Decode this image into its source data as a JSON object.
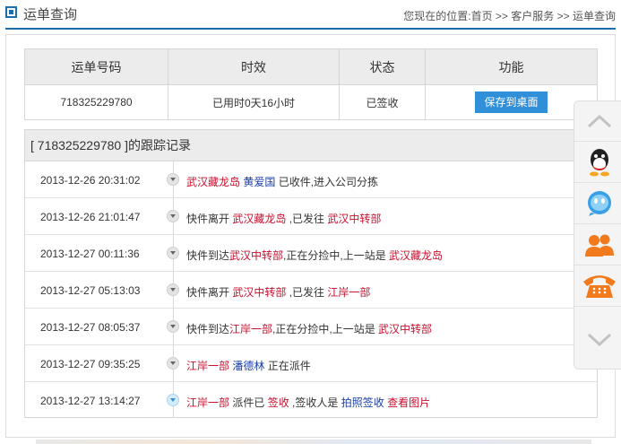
{
  "header": {
    "title": "运单查询",
    "breadcrumb": {
      "prefix": "您现在的位置:",
      "home": "首页",
      "sep1": " >> ",
      "service": "客户服务",
      "sep2": " >> ",
      "current": "运单查询"
    }
  },
  "summary": {
    "columns": [
      "运单号码",
      "时效",
      "状态",
      "功能"
    ],
    "row": {
      "tracking_number": "718325229780",
      "duration": "已用时0天16小时",
      "status": "已签收",
      "action_label": "保存到桌面"
    }
  },
  "tracking": {
    "title": "[ 718325229780 ]的跟踪记录",
    "records": [
      {
        "time": "2013-12-26 20:31:02",
        "parts": [
          {
            "t": "武汉藏龙岛",
            "c": "red"
          },
          {
            "t": " ",
            "c": ""
          },
          {
            "t": "黄爱国",
            "c": "blue"
          },
          {
            "t": " 已收件,进入公司分拣",
            "c": ""
          }
        ]
      },
      {
        "time": "2013-12-26 21:01:47",
        "parts": [
          {
            "t": "快件离开 ",
            "c": ""
          },
          {
            "t": "武汉藏龙岛",
            "c": "red"
          },
          {
            "t": " ,已发往 ",
            "c": ""
          },
          {
            "t": "武汉中转部",
            "c": "red"
          }
        ]
      },
      {
        "time": "2013-12-27 00:11:36",
        "parts": [
          {
            "t": "快件到达",
            "c": ""
          },
          {
            "t": "武汉中转部",
            "c": "red"
          },
          {
            "t": ",正在分捡中,上一站是 ",
            "c": ""
          },
          {
            "t": "武汉藏龙岛",
            "c": "red"
          }
        ]
      },
      {
        "time": "2013-12-27 05:13:03",
        "parts": [
          {
            "t": "快件离开 ",
            "c": ""
          },
          {
            "t": "武汉中转部",
            "c": "red"
          },
          {
            "t": " ,已发往 ",
            "c": ""
          },
          {
            "t": "江岸一部",
            "c": "red"
          }
        ]
      },
      {
        "time": "2013-12-27 08:05:37",
        "parts": [
          {
            "t": "快件到达",
            "c": ""
          },
          {
            "t": "江岸一部",
            "c": "red"
          },
          {
            "t": ",正在分捡中,上一站是 ",
            "c": ""
          },
          {
            "t": "武汉中转部",
            "c": "red"
          }
        ]
      },
      {
        "time": "2013-12-27 09:35:25",
        "parts": [
          {
            "t": "江岸一部",
            "c": "red"
          },
          {
            "t": " ",
            "c": ""
          },
          {
            "t": "潘德林",
            "c": "blue"
          },
          {
            "t": " 正在派件",
            "c": ""
          }
        ]
      },
      {
        "time": "2013-12-27 13:14:27",
        "parts": [
          {
            "t": "江岸一部",
            "c": "red"
          },
          {
            "t": " 派件已 ",
            "c": ""
          },
          {
            "t": "签收",
            "c": "red"
          },
          {
            "t": " ,签收人是 ",
            "c": ""
          },
          {
            "t": "拍照签收",
            "c": "blue"
          },
          {
            "t": " ",
            "c": ""
          },
          {
            "t": "查看图片",
            "c": "red"
          }
        ]
      }
    ]
  },
  "side_toolbar": {
    "items": [
      "up-arrow-icon",
      "qq-icon",
      "chat-bubble-icon",
      "contacts-icon",
      "phone-icon",
      "down-arrow-icon"
    ]
  },
  "colors": {
    "accent": "#1b6eae",
    "button": "#2f8fd8",
    "highlight_red": "#c8102e",
    "highlight_blue": "#1a3ea8",
    "header_bg": "#ececec",
    "phone_orange": "#f07a1c"
  }
}
